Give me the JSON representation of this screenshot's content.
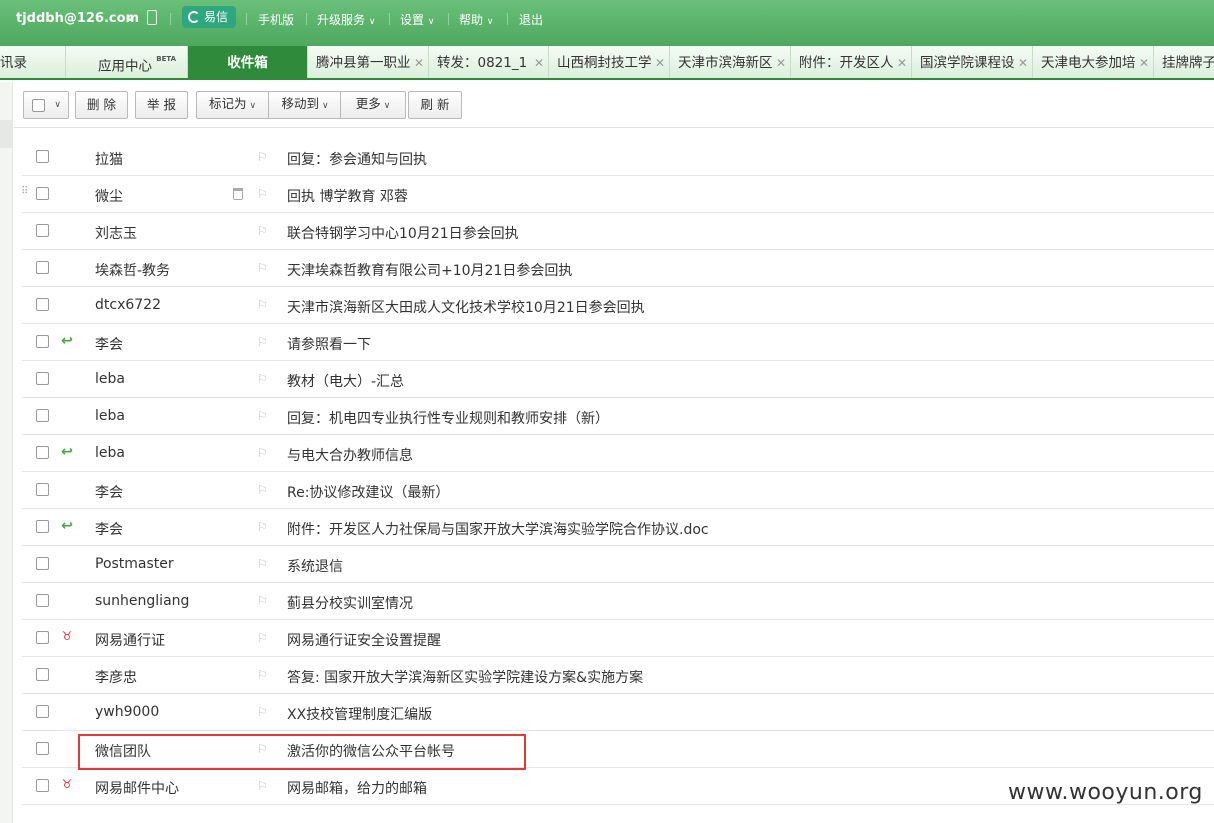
{
  "header": {
    "account": "tjddbh@126.com",
    "yixin_label": "易信",
    "links": [
      "手机版",
      "升级服务",
      "设置",
      "帮助",
      "退出"
    ]
  },
  "tabs": [
    {
      "label": "讯录"
    },
    {
      "label": "应用中心",
      "badge": "BETA"
    },
    {
      "label": "收件箱",
      "active": true
    },
    {
      "label": "腾冲县第一职业"
    },
    {
      "label": "转发：0821_1"
    },
    {
      "label": "山西桐封技工学"
    },
    {
      "label": "天津市滨海新区"
    },
    {
      "label": "附件：开发区人"
    },
    {
      "label": "国滨学院课程设"
    },
    {
      "label": "天津电大参加培"
    },
    {
      "label": "挂牌牌子"
    }
  ],
  "toolbar": {
    "delete": "删 除",
    "report": "举 报",
    "mark_as": "标记为",
    "move_to": "移动到",
    "more": "更多",
    "refresh": "刷 新"
  },
  "mails": [
    {
      "sender": "拉猫",
      "subject": "回复：参会通知与回执",
      "status": ""
    },
    {
      "sender": "微尘",
      "subject": "回执 博学教育 邓蓉",
      "status": "",
      "hover": true
    },
    {
      "sender": "刘志玉",
      "subject": "联合特钢学习中心10月21日参会回执",
      "status": ""
    },
    {
      "sender": "埃森哲-教务",
      "subject": "天津埃森哲教育有限公司+10月21日参会回执",
      "status": ""
    },
    {
      "sender": "dtcx6722",
      "subject": "天津市滨海新区大田成人文化技术学校10月21日参会回执",
      "status": ""
    },
    {
      "sender": "李会",
      "subject": "请参照看一下",
      "status": "replied"
    },
    {
      "sender": "leba",
      "subject": "教材（电大）-汇总",
      "status": ""
    },
    {
      "sender": "leba",
      "subject": "回复：机电四专业执行性专业规则和教师安排（新）",
      "status": ""
    },
    {
      "sender": "leba",
      "subject": "与电大合办教师信息",
      "status": "replied"
    },
    {
      "sender": "李会",
      "subject": "Re:协议修改建议（最新）",
      "status": ""
    },
    {
      "sender": "李会",
      "subject": "附件：开发区人力社保局与国家开放大学滨海实验学院合作协议.doc",
      "status": "replied"
    },
    {
      "sender": "Postmaster",
      "subject": "系统退信",
      "status": ""
    },
    {
      "sender": "sunhengliang",
      "subject": "蓟县分校实训室情况",
      "status": ""
    },
    {
      "sender": "网易通行证",
      "subject": "网易通行证安全设置提醒",
      "status": "alert"
    },
    {
      "sender": "李彦忠",
      "subject": "答复: 国家开放大学滨海新区实验学院建设方案&实施方案",
      "status": ""
    },
    {
      "sender": "ywh9000",
      "subject": "XX技校管理制度汇编版",
      "status": ""
    },
    {
      "sender": "微信团队",
      "subject": "激活你的微信公众平台帐号",
      "status": ""
    },
    {
      "sender": "网易邮件中心",
      "subject": "网易邮箱，给力的邮箱",
      "status": "alert"
    }
  ],
  "watermark": "www.wooyun.org"
}
